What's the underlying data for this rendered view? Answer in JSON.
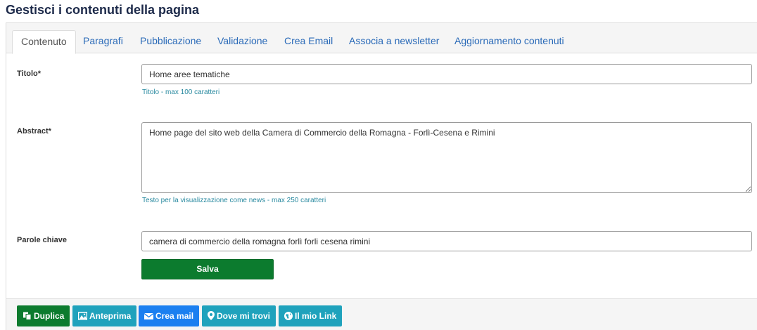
{
  "page": {
    "title": "Gestisci i contenuti della pagina"
  },
  "tabs": [
    {
      "label": "Contenuto",
      "active": true
    },
    {
      "label": "Paragrafi",
      "active": false
    },
    {
      "label": "Pubblicazione",
      "active": false
    },
    {
      "label": "Validazione",
      "active": false
    },
    {
      "label": "Crea Email",
      "active": false
    },
    {
      "label": "Associa a newsletter",
      "active": false
    },
    {
      "label": "Aggiornamento contenuti",
      "active": false
    }
  ],
  "form": {
    "titolo": {
      "label": "Titolo*",
      "value": "Home aree tematiche",
      "help": "Titolo - max 100 caratteri"
    },
    "abstract": {
      "label": "Abstract*",
      "value": "Home page del sito web della Camera di Commercio della Romagna - Forlì-Cesena e Rimini",
      "help": "Testo per la visualizzazione come news - max 250 caratteri"
    },
    "parole_chiave": {
      "label": "Parole chiave",
      "value": "camera di commercio della romagna forlì forli cesena rimini"
    },
    "save_label": "Salva"
  },
  "footer": {
    "buttons": [
      {
        "label": "Duplica",
        "icon": "copy-icon",
        "color": "#0c7b2e"
      },
      {
        "label": "Anteprima",
        "icon": "image-icon",
        "color": "#1fa2bc"
      },
      {
        "label": "Crea mail",
        "icon": "envelope-icon",
        "color": "#1b7ff0"
      },
      {
        "label": "Dove mi trovi",
        "icon": "map-marker-icon",
        "color": "#1fa2bc"
      },
      {
        "label": "Il mio Link",
        "icon": "globe-icon",
        "color": "#1fa2bc"
      }
    ]
  }
}
